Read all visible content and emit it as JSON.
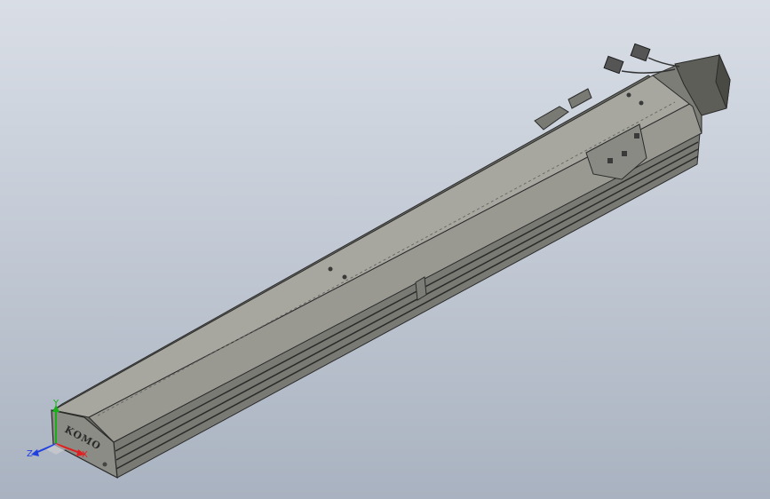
{
  "viewport": {
    "background_top": "#d9dee6",
    "background_bottom": "#a9b2c0"
  },
  "model": {
    "brand_label": "KOMO",
    "body_color": "#8c8c86",
    "top_face_color": "#a7a79f",
    "side_face_color": "#6c6c66",
    "edge_color": "#2a2a2a",
    "motor_color": "#5e5e58"
  },
  "triad": {
    "x_label": "X",
    "y_label": "Y",
    "z_label": "Z",
    "x_color": "#e02020",
    "y_color": "#18b018",
    "z_color": "#2040e0"
  }
}
